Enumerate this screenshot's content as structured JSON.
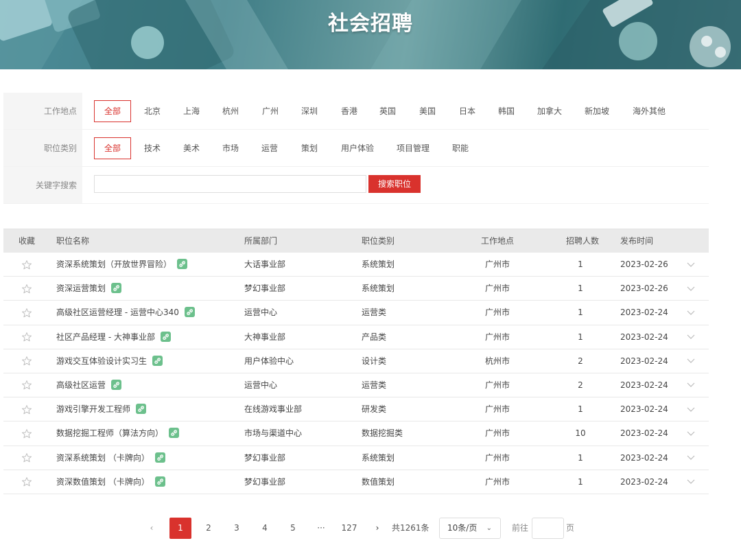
{
  "banner": {
    "title": "社会招聘"
  },
  "filters": {
    "location": {
      "label": "工作地点",
      "options": [
        "全部",
        "北京",
        "上海",
        "杭州",
        "广州",
        "深圳",
        "香港",
        "英国",
        "美国",
        "日本",
        "韩国",
        "加拿大",
        "新加坡",
        "海外其他"
      ],
      "selected": "全部"
    },
    "category": {
      "label": "职位类别",
      "options": [
        "全部",
        "技术",
        "美术",
        "市场",
        "运营",
        "策划",
        "用户体验",
        "项目管理",
        "职能"
      ],
      "selected": "全部"
    },
    "keyword": {
      "label": "关键字搜索",
      "value": "",
      "placeholder": "",
      "button": "搜索职位"
    }
  },
  "table": {
    "columns": {
      "fav": "收藏",
      "name": "职位名称",
      "dept": "所属部门",
      "type": "职位类别",
      "city": "工作地点",
      "count": "招聘人数",
      "date": "发布时间"
    },
    "rows": [
      {
        "name": "资深系统策划（开放世界冒险）",
        "dept": "大话事业部",
        "type": "系统策划",
        "city": "广州市",
        "count": "1",
        "date": "2023-02-26"
      },
      {
        "name": "资深运营策划",
        "dept": "梦幻事业部",
        "type": "系统策划",
        "city": "广州市",
        "count": "1",
        "date": "2023-02-26"
      },
      {
        "name": "高级社区运营经理 - 运营中心340",
        "dept": "运营中心",
        "type": "运营类",
        "city": "广州市",
        "count": "1",
        "date": "2023-02-24"
      },
      {
        "name": "社区产品经理 - 大神事业部",
        "dept": "大神事业部",
        "type": "产品类",
        "city": "广州市",
        "count": "1",
        "date": "2023-02-24"
      },
      {
        "name": "游戏交互体验设计实习生",
        "dept": "用户体验中心",
        "type": "设计类",
        "city": "杭州市",
        "count": "2",
        "date": "2023-02-24"
      },
      {
        "name": "高级社区运营",
        "dept": "运营中心",
        "type": "运营类",
        "city": "广州市",
        "count": "2",
        "date": "2023-02-24"
      },
      {
        "name": "游戏引擎开发工程师",
        "dept": "在线游戏事业部",
        "type": "研发类",
        "city": "广州市",
        "count": "1",
        "date": "2023-02-24"
      },
      {
        "name": "数据挖掘工程师（算法方向）",
        "dept": "市场与渠道中心",
        "type": "数据挖掘类",
        "city": "广州市",
        "count": "10",
        "date": "2023-02-24"
      },
      {
        "name": "资深系统策划 （卡牌向）",
        "dept": "梦幻事业部",
        "type": "系统策划",
        "city": "广州市",
        "count": "1",
        "date": "2023-02-24"
      },
      {
        "name": "资深数值策划 （卡牌向）",
        "dept": "梦幻事业部",
        "type": "数值策划",
        "city": "广州市",
        "count": "1",
        "date": "2023-02-24"
      }
    ]
  },
  "pagination": {
    "prev": "‹",
    "pages": [
      "1",
      "2",
      "3",
      "4",
      "5"
    ],
    "active_page": "1",
    "ellipsis": "···",
    "last_page": "127",
    "next": "›",
    "total": "共1261条",
    "page_size": "10条/页",
    "goto_prefix": "前往",
    "goto_value": "",
    "goto_suffix": "页"
  },
  "colors": {
    "accent": "#d9322d",
    "link_icon": "#6cc08c",
    "banner": "#3f7d86"
  },
  "icons": {
    "favorite": "star-outline-icon",
    "link": "link-icon",
    "expand": "chevron-down-icon"
  }
}
